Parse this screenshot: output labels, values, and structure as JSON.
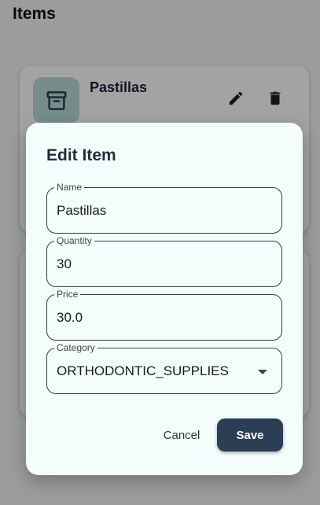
{
  "page": {
    "title": "Items"
  },
  "list": {
    "items": [
      {
        "name": "Pastillas",
        "icon": "archive-icon",
        "actions": {
          "edit_icon": "pencil-icon",
          "delete_icon": "trash-icon"
        }
      },
      {
        "name": "",
        "icon": ""
      }
    ]
  },
  "dialog": {
    "title": "Edit Item",
    "fields": {
      "name": {
        "label": "Name",
        "value": "Pastillas"
      },
      "quantity": {
        "label": "Quantity",
        "value": "30"
      },
      "price": {
        "label": "Price",
        "value": "30.0"
      },
      "category": {
        "label": "Category",
        "value": "ORTHODONTIC_SUPPLIES",
        "icon": "dropdown-arrow-icon"
      }
    },
    "buttons": {
      "cancel_label": "Cancel",
      "save_label": "Save"
    }
  },
  "colors": {
    "primary": "#2c3e55",
    "dialog_background": "#f2fdfc",
    "icon_tile": "#b9ddd6",
    "page_background": "#f4f4f4"
  }
}
